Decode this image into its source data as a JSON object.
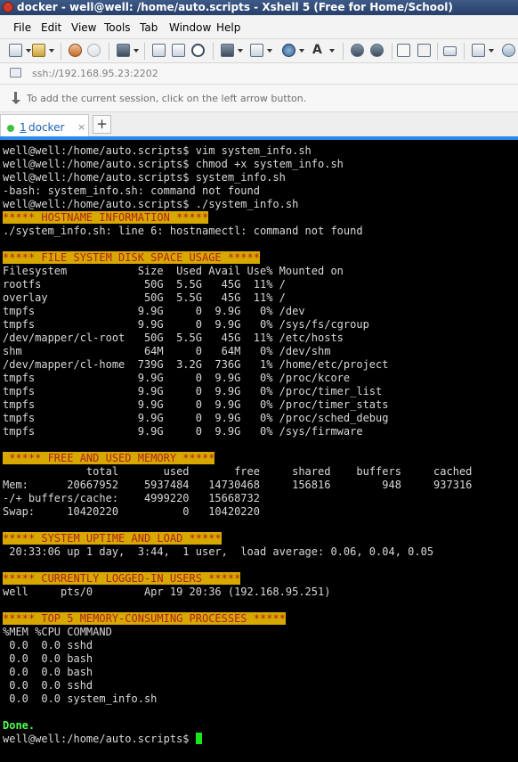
{
  "window": {
    "title": "docker - well@well: /home/auto.scripts - Xshell 5 (Free for Home/School)"
  },
  "menu": [
    "File",
    "Edit",
    "View",
    "Tools",
    "Tab",
    "Window",
    "Help"
  ],
  "toolbar": {
    "icons": [
      "new-session-icon",
      "open-folder-icon",
      "reconnect-icon",
      "disconnect-icon",
      "properties-icon",
      "copy-icon",
      "paste-icon",
      "find-icon",
      "print-icon",
      "transfer-icon",
      "globe-icon",
      "font-icon",
      "xftp-icon",
      "xagent-icon",
      "fullscreen-icon",
      "lock-icon",
      "keyboard-icon",
      "new-window-icon",
      "help-icon"
    ]
  },
  "address": {
    "value": "ssh://192.168.95.23:2202"
  },
  "hint": {
    "text": "To add the current session, click on the left arrow button."
  },
  "tabs": [
    {
      "number": "1",
      "name": "docker",
      "close": "×"
    }
  ],
  "new_tab_label": "+",
  "colors": {
    "terminal_bg": "#000000",
    "terminal_fg": "#d9d9d9",
    "highlight_bg": "#d7a900",
    "highlight_fg": "#b02020",
    "cursor": "#19e619",
    "accent": "#2b8be6"
  },
  "terminal": {
    "lines": [
      {
        "text": "well@well:/home/auto.scripts$ vim system_info.sh"
      },
      {
        "text": "well@well:/home/auto.scripts$ chmod +x system_info.sh"
      },
      {
        "text": "well@well:/home/auto.scripts$ system_info.sh"
      },
      {
        "text": "-bash: system_info.sh: command not found"
      },
      {
        "text": "well@well:/home/auto.scripts$ ./system_info.sh"
      },
      {
        "text": "***** HOSTNAME INFORMATION *****",
        "style": "hl"
      },
      {
        "text": "./system_info.sh: line 6: hostnamectl: command not found"
      },
      {
        "text": ""
      },
      {
        "text": "***** FILE SYSTEM DISK SPACE USAGE *****",
        "style": "hl"
      },
      {
        "text": "Filesystem           Size  Used Avail Use% Mounted on"
      },
      {
        "text": "rootfs                50G  5.5G   45G  11% /"
      },
      {
        "text": "overlay               50G  5.5G   45G  11% /"
      },
      {
        "text": "tmpfs                9.9G     0  9.9G   0% /dev"
      },
      {
        "text": "tmpfs                9.9G     0  9.9G   0% /sys/fs/cgroup"
      },
      {
        "text": "/dev/mapper/cl-root   50G  5.5G   45G  11% /etc/hosts"
      },
      {
        "text": "shm                   64M     0   64M   0% /dev/shm"
      },
      {
        "text": "/dev/mapper/cl-home  739G  3.2G  736G   1% /home/etc/project"
      },
      {
        "text": "tmpfs                9.9G     0  9.9G   0% /proc/kcore"
      },
      {
        "text": "tmpfs                9.9G     0  9.9G   0% /proc/timer_list"
      },
      {
        "text": "tmpfs                9.9G     0  9.9G   0% /proc/timer_stats"
      },
      {
        "text": "tmpfs                9.9G     0  9.9G   0% /proc/sched_debug"
      },
      {
        "text": "tmpfs                9.9G     0  9.9G   0% /sys/firmware"
      },
      {
        "text": ""
      },
      {
        "text": " ***** FREE AND USED MEMORY *****",
        "style": "hl"
      },
      {
        "text": "             total       used       free     shared    buffers     cached"
      },
      {
        "text": "Mem:      20667952    5937484   14730468     156816        948     937316"
      },
      {
        "text": "-/+ buffers/cache:    4999220   15668732"
      },
      {
        "text": "Swap:     10420220          0   10420220"
      },
      {
        "text": ""
      },
      {
        "text": "***** SYSTEM UPTIME AND LOAD *****",
        "style": "hl"
      },
      {
        "text": " 20:33:06 up 1 day,  3:44,  1 user,  load average: 0.06, 0.04, 0.05"
      },
      {
        "text": ""
      },
      {
        "text": "***** CURRENTLY LOGGED-IN USERS *****",
        "style": "hl"
      },
      {
        "text": "well     pts/0        Apr 19 20:36 (192.168.95.251)"
      },
      {
        "text": ""
      },
      {
        "text": "***** TOP 5 MEMORY-CONSUMING PROCESSES *****",
        "style": "hl"
      },
      {
        "text": "%MEM %CPU COMMAND"
      },
      {
        "text": " 0.0  0.0 sshd"
      },
      {
        "text": " 0.0  0.0 bash"
      },
      {
        "text": " 0.0  0.0 bash"
      },
      {
        "text": " 0.0  0.0 sshd"
      },
      {
        "text": " 0.0  0.0 system_info.sh"
      },
      {
        "text": ""
      },
      {
        "text": "Done.",
        "style": "green"
      },
      {
        "text": "well@well:/home/auto.scripts$ ",
        "cursor": true
      }
    ]
  }
}
